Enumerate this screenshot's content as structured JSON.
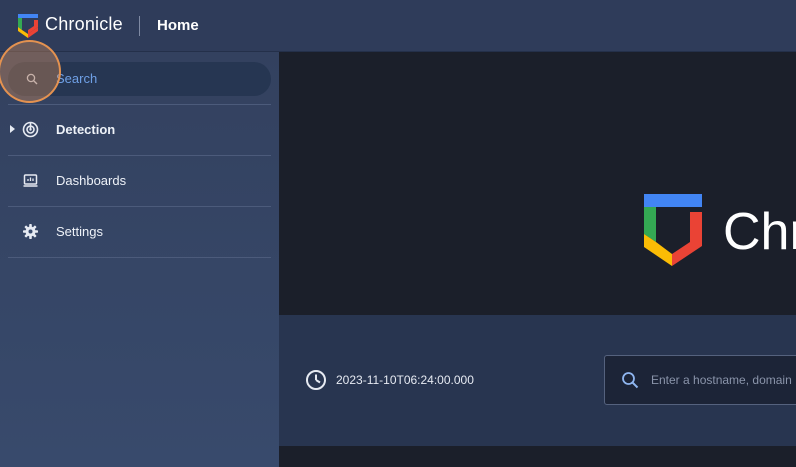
{
  "header": {
    "brand": "Chronicle",
    "page": "Home"
  },
  "sidebar": {
    "search": {
      "placeholder": "Search"
    },
    "items": [
      {
        "label": "Detection",
        "icon": "radar-icon",
        "expandable": true
      },
      {
        "label": "Dashboards",
        "icon": "dashboard-icon",
        "expandable": false
      },
      {
        "label": "Settings",
        "icon": "gear-icon",
        "expandable": false
      }
    ]
  },
  "main": {
    "hero_brand": "Chronicle",
    "timestamp": "2023-11-10T06:24:00.000",
    "host_search": {
      "placeholder": "Enter a hostname, domain"
    }
  },
  "colors": {
    "topbar": "#2f3c5a",
    "sidebar": "#33415f",
    "accent_link": "#6fa0e6",
    "logo_blue": "#4285f4",
    "logo_green": "#34a853",
    "logo_yellow": "#fbbc05",
    "logo_red": "#ea4335",
    "click_indicator": "#eb9650"
  }
}
